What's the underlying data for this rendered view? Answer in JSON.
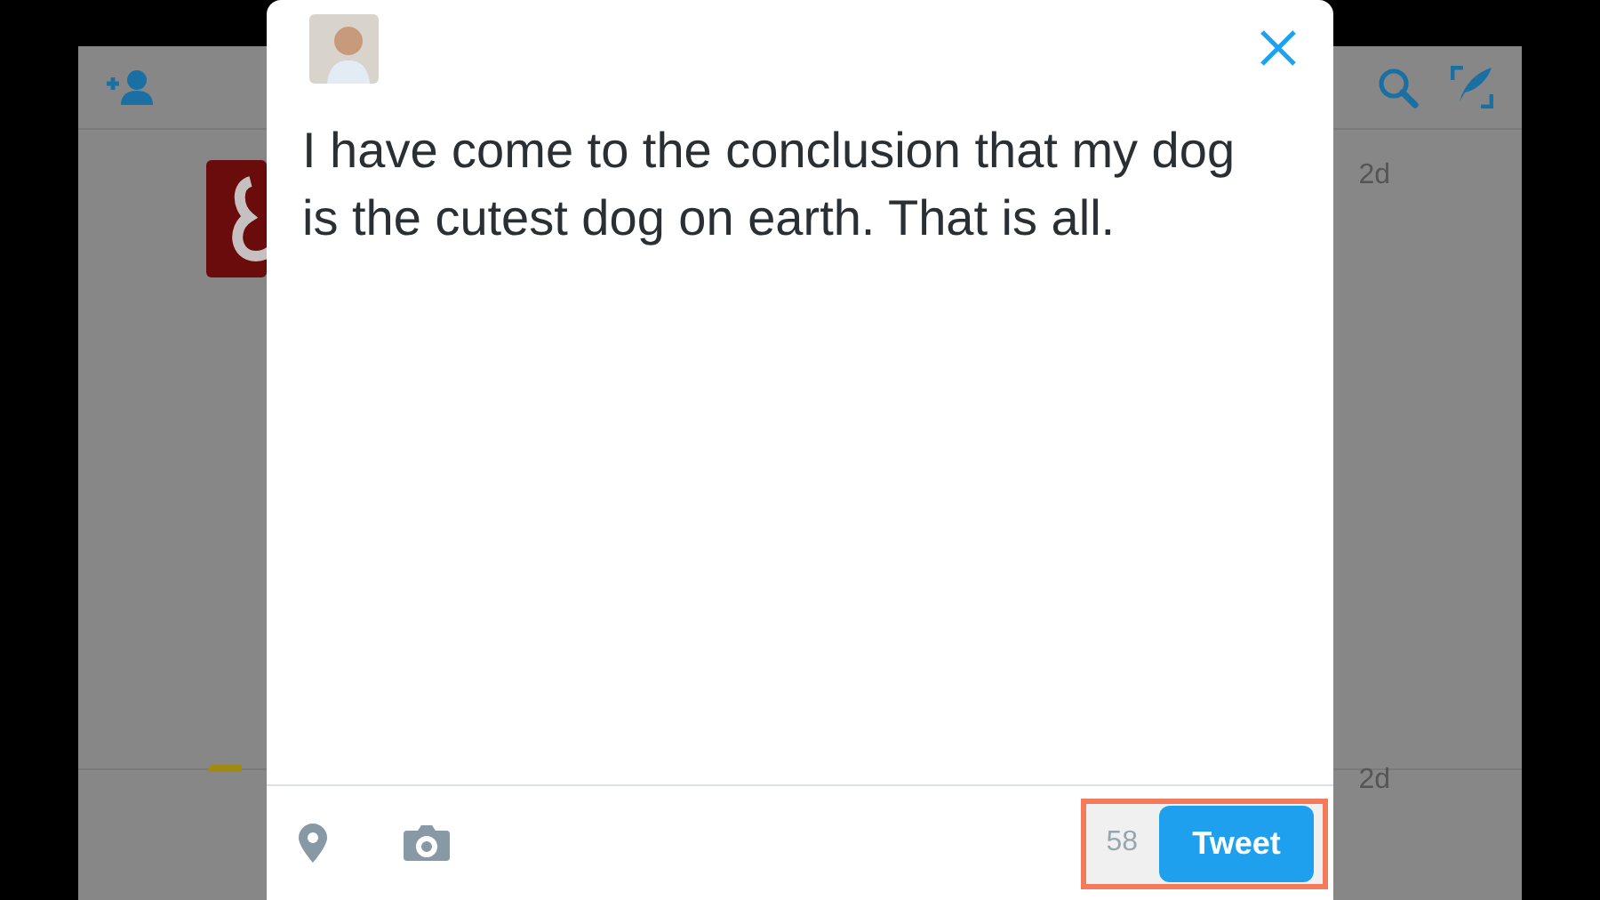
{
  "timeline": [
    {
      "time": "2d"
    },
    {
      "time": "2d"
    }
  ],
  "composer": {
    "text": "I have come to the conclusion that my dog is the cutest dog on earth. That is all.",
    "char_count": "58",
    "submit_button": "Tweet"
  }
}
